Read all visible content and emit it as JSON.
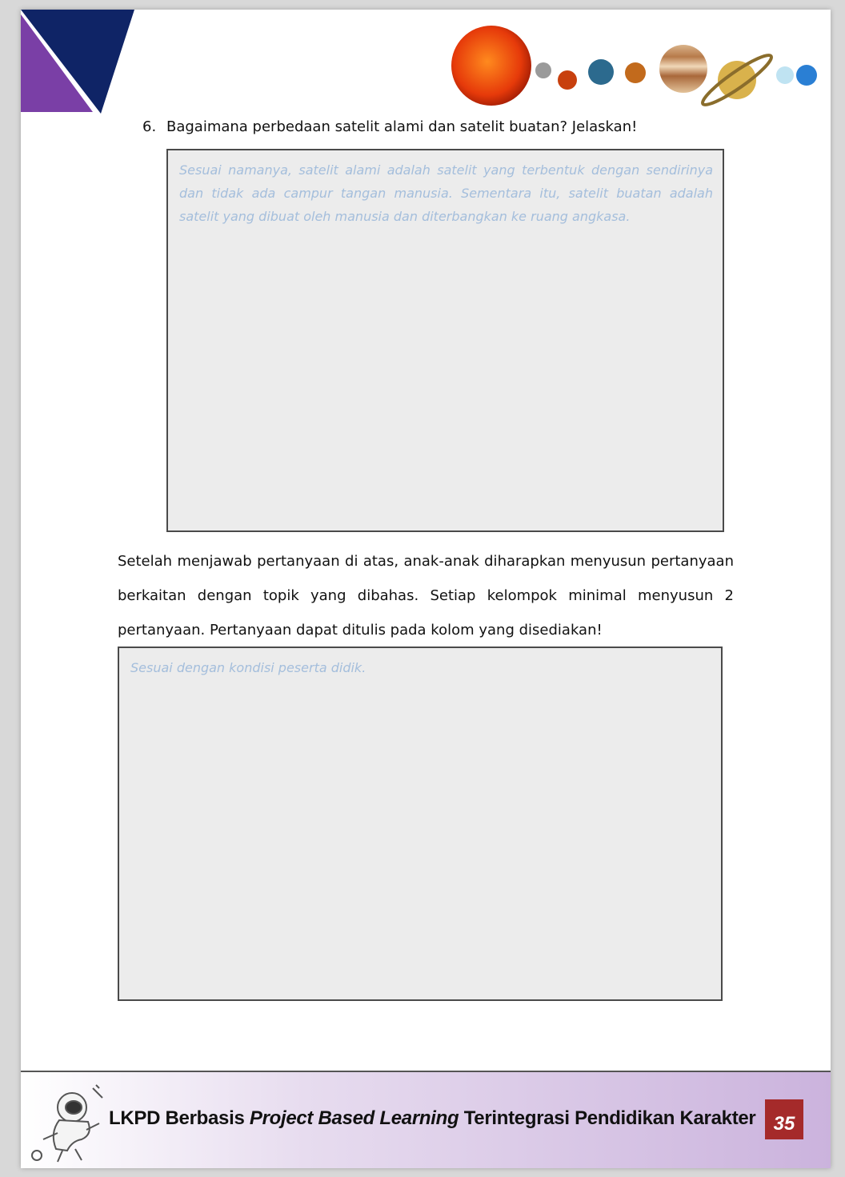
{
  "question": {
    "number": "6.",
    "text": "Bagaimana perbedaan satelit alami dan satelit buatan? Jelaskan!",
    "answer_hint": "Sesuai namanya, satelit alami adalah satelit yang terbentuk dengan sendirinya dan tidak ada campur tangan manusia. Sementara itu, satelit buatan adalah satelit yang dibuat oleh manusia dan diterbangkan ke ruang angkasa."
  },
  "instruction": {
    "text": "Setelah menjawab pertanyaan di atas, anak-anak diharapkan menyusun pertanyaan berkaitan dengan topik yang dibahas. Setiap kelompok minimal menyusun 2 pertanyaan. Pertanyaan dapat ditulis pada kolom yang disediakan!",
    "answer_hint": "Sesuai dengan kondisi peserta didik."
  },
  "footer": {
    "title_part1": "LKPD Berbasis ",
    "title_italic": "Project Based Learning",
    "title_part2": " Terintegrasi Pendidikan Karakter",
    "page_number": "35"
  },
  "colors": {
    "corner_purple": "#7a3fa6",
    "corner_navy": "#0f2466",
    "hint_text": "#a4bedc",
    "page_number_bg": "#a52a2a"
  }
}
